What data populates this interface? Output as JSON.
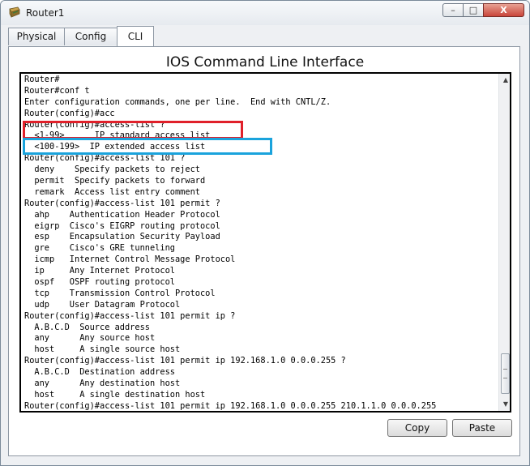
{
  "window": {
    "title": "Router1",
    "controls": {
      "minimize": "–",
      "maximize": "□",
      "close": "X"
    }
  },
  "tabs": [
    {
      "label": "Physical",
      "active": false
    },
    {
      "label": "Config",
      "active": false
    },
    {
      "label": "CLI",
      "active": true
    }
  ],
  "cli": {
    "heading": "IOS Command Line Interface",
    "lines": [
      "Router#",
      "Router#conf t",
      "Enter configuration commands, one per line.  End with CNTL/Z.",
      "Router(config)#acc",
      "Router(config)#access-list ?",
      "  <1-99>      IP standard access list",
      "  <100-199>  IP extended access list",
      "Router(config)#access-list 101 ?",
      "  deny    Specify packets to reject",
      "  permit  Specify packets to forward",
      "  remark  Access list entry comment",
      "Router(config)#access-list 101 permit ?",
      "  ahp    Authentication Header Protocol",
      "  eigrp  Cisco's EIGRP routing protocol",
      "  esp    Encapsulation Security Payload",
      "  gre    Cisco's GRE tunneling",
      "  icmp   Internet Control Message Protocol",
      "  ip     Any Internet Protocol",
      "  ospf   OSPF routing protocol",
      "  tcp    Transmission Control Protocol",
      "  udp    User Datagram Protocol",
      "Router(config)#access-list 101 permit ip ?",
      "  A.B.C.D  Source address",
      "  any      Any source host",
      "  host     A single source host",
      "Router(config)#access-list 101 permit ip 192.168.1.0 0.0.0.255 ?",
      "  A.B.C.D  Destination address",
      "  any      Any destination host",
      "  host     A single destination host",
      "Router(config)#access-list 101 permit ip 192.168.1.0 0.0.0.255 210.1.1.0 0.0.0.255"
    ]
  },
  "buttons": {
    "copy": "Copy",
    "paste": "Paste"
  },
  "colors": {
    "highlight_red": "#e0202a",
    "highlight_blue": "#1aa3dc"
  },
  "icons": {
    "app": "router-device-icon"
  }
}
